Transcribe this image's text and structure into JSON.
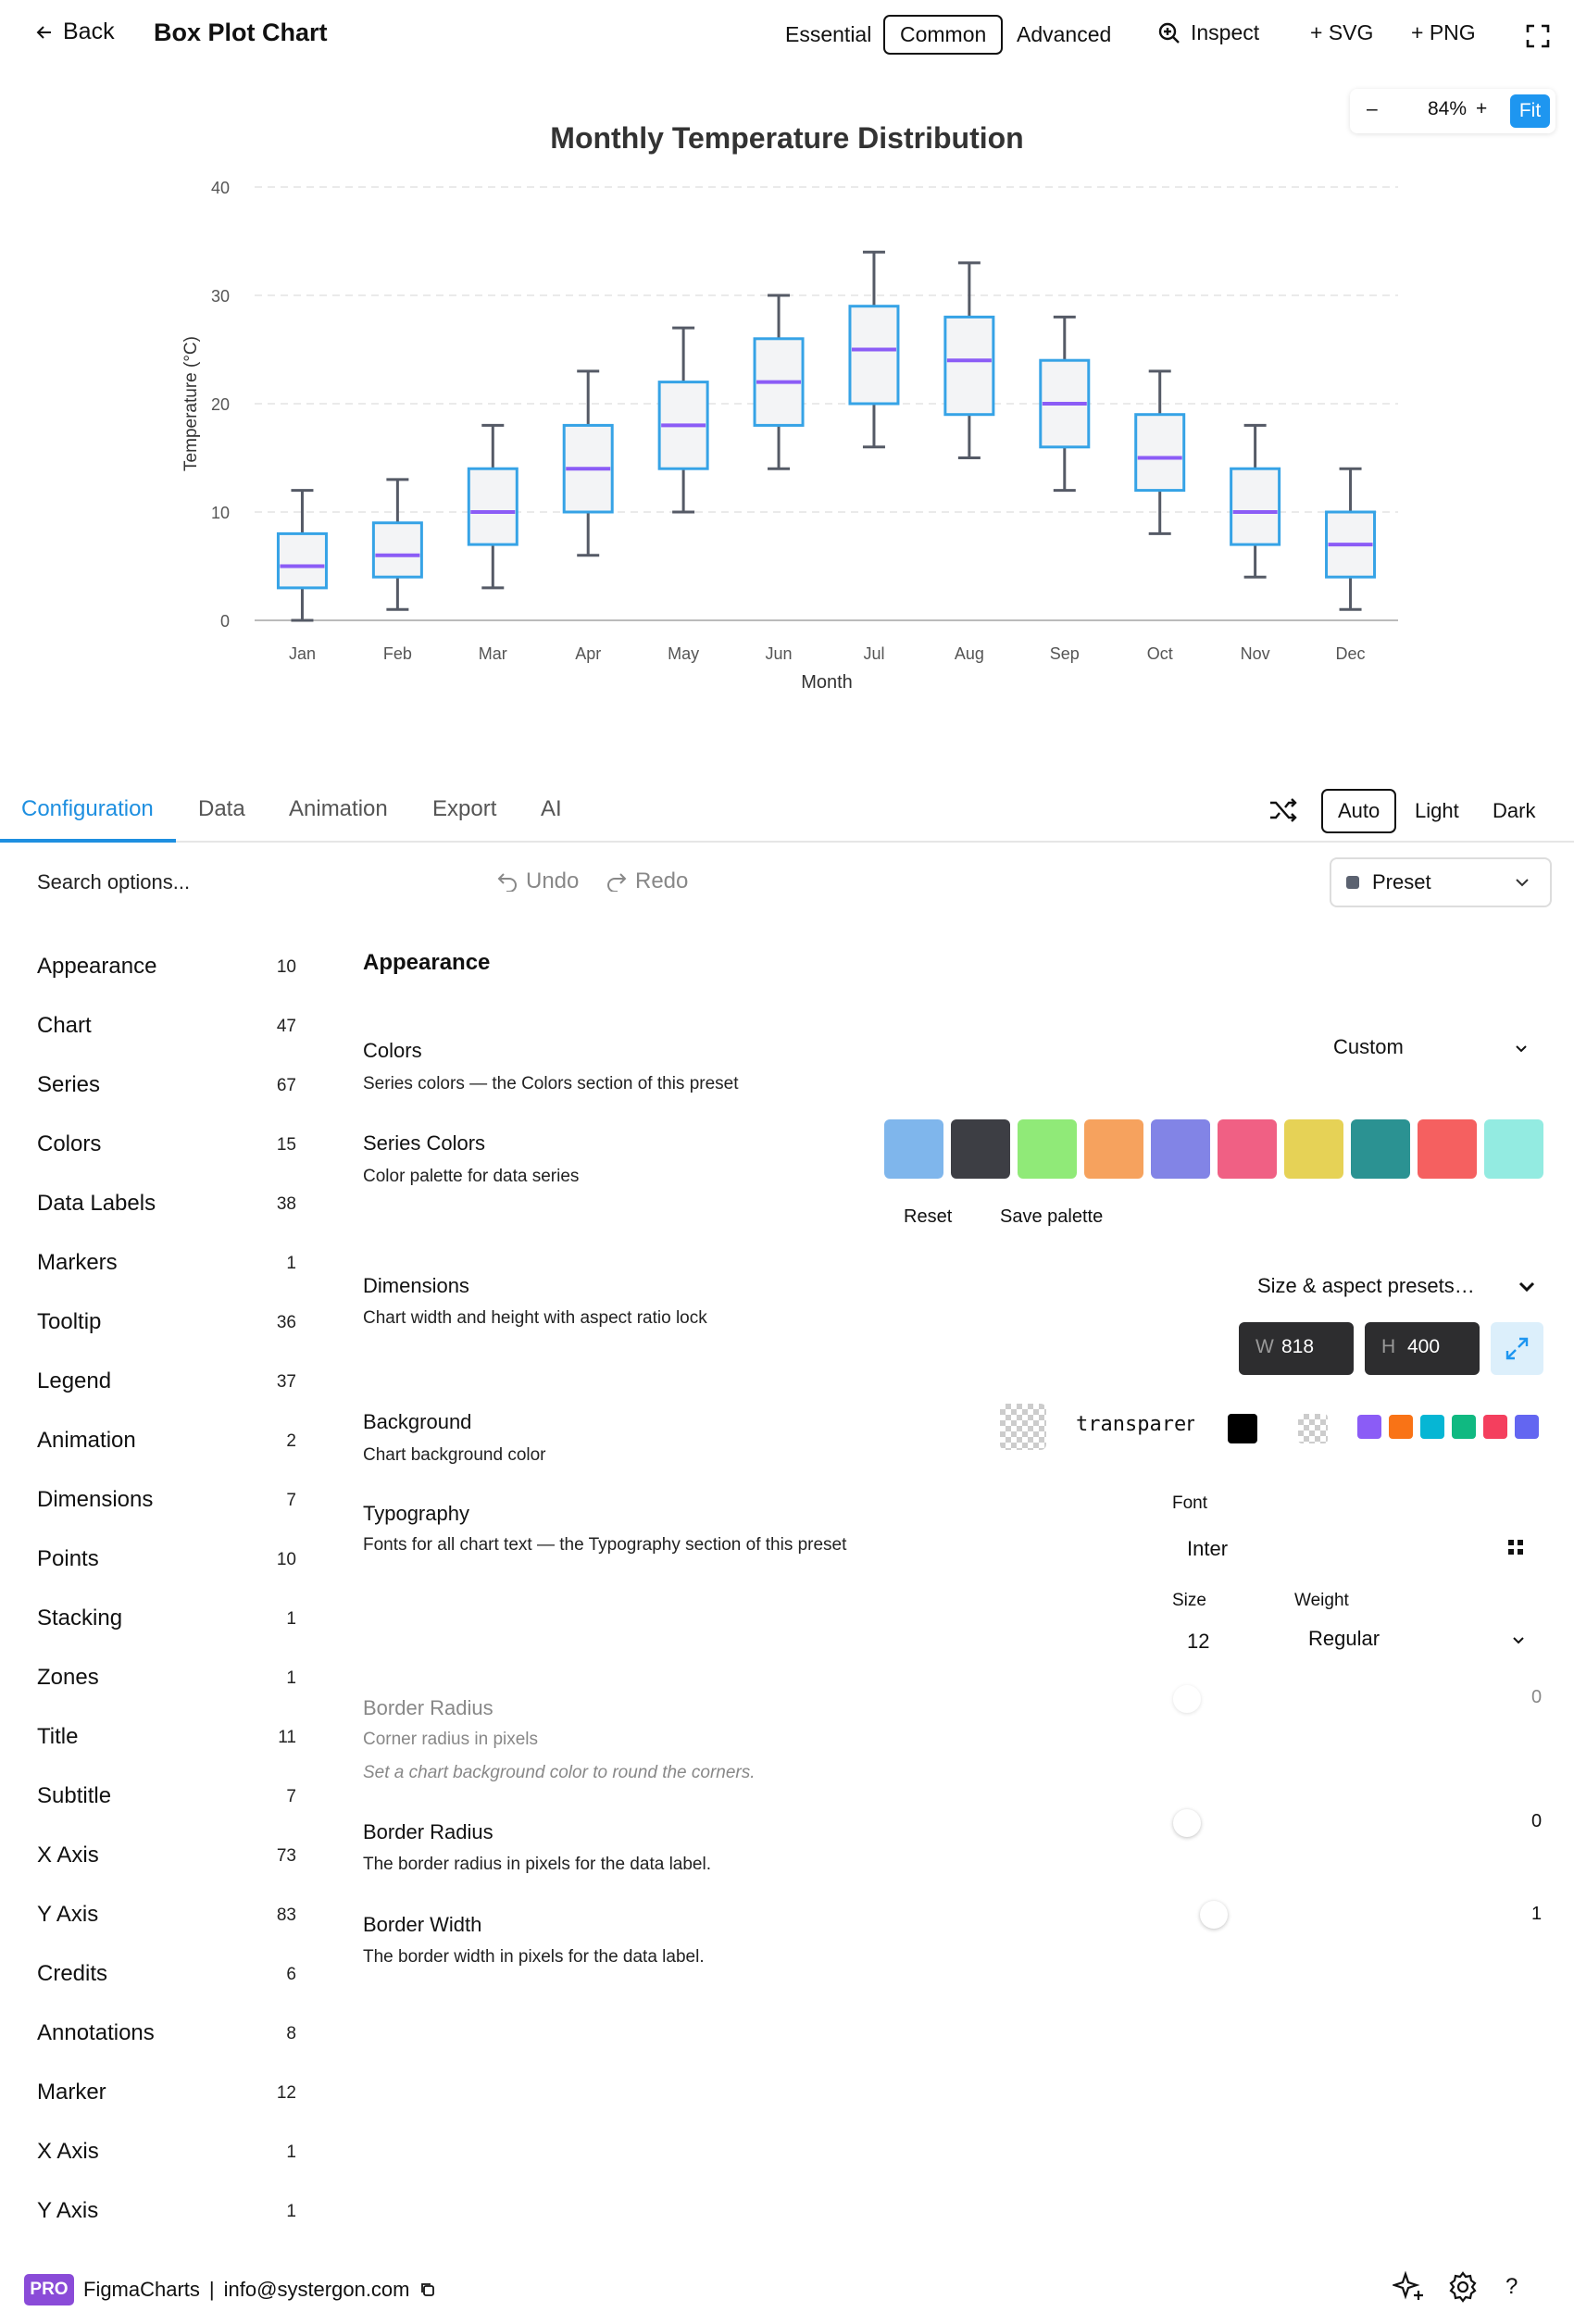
{
  "header": {
    "back_label": "Back",
    "title": "Box Plot Chart",
    "modes": [
      "Essential",
      "Common",
      "Advanced"
    ],
    "active_mode": "Common",
    "inspect_label": "Inspect",
    "svg_label": "+ SVG",
    "png_label": "+ PNG"
  },
  "zoom": {
    "minus": "–",
    "value": "84%",
    "plus": "+",
    "fit": "Fit"
  },
  "chart_data": {
    "type": "boxplot",
    "title": "Monthly Temperature Distribution",
    "xlabel": "Month",
    "ylabel": "Temperature (°C)",
    "ylim": [
      0,
      40
    ],
    "yticks": [
      0,
      10,
      20,
      30,
      40
    ],
    "grid": true,
    "categories": [
      "Jan",
      "Feb",
      "Mar",
      "Apr",
      "May",
      "Jun",
      "Jul",
      "Aug",
      "Sep",
      "Oct",
      "Nov",
      "Dec"
    ],
    "series": [
      {
        "values": [
          {
            "min": 0,
            "q1": 3,
            "median": 5,
            "q3": 8,
            "max": 12
          },
          {
            "min": 1,
            "q1": 4,
            "median": 6,
            "q3": 9,
            "max": 13
          },
          {
            "min": 3,
            "q1": 7,
            "median": 10,
            "q3": 14,
            "max": 18
          },
          {
            "min": 6,
            "q1": 10,
            "median": 14,
            "q3": 18,
            "max": 23
          },
          {
            "min": 10,
            "q1": 14,
            "median": 18,
            "q3": 22,
            "max": 27
          },
          {
            "min": 14,
            "q1": 18,
            "median": 22,
            "q3": 26,
            "max": 30
          },
          {
            "min": 16,
            "q1": 20,
            "median": 25,
            "q3": 29,
            "max": 34
          },
          {
            "min": 15,
            "q1": 19,
            "median": 24,
            "q3": 28,
            "max": 33
          },
          {
            "min": 12,
            "q1": 16,
            "median": 20,
            "q3": 24,
            "max": 28
          },
          {
            "min": 8,
            "q1": 12,
            "median": 15,
            "q3": 19,
            "max": 23
          },
          {
            "min": 4,
            "q1": 7,
            "median": 10,
            "q3": 14,
            "max": 18
          },
          {
            "min": 1,
            "q1": 4,
            "median": 7,
            "q3": 10,
            "max": 14
          }
        ]
      }
    ],
    "colors": {
      "box_stroke": "#36a3e6",
      "box_fill": "#f3f4f6",
      "median": "#8b5cf6",
      "whisker": "#555a66",
      "grid": "#e4e4e4"
    }
  },
  "tabs": {
    "items": [
      "Configuration",
      "Data",
      "Animation",
      "Export",
      "AI"
    ],
    "active": "Configuration",
    "themes": [
      "Auto",
      "Light",
      "Dark"
    ],
    "active_theme": "Auto"
  },
  "toolbar": {
    "search_placeholder": "Search options...",
    "undo": "Undo",
    "redo": "Redo",
    "preset": "Preset"
  },
  "sidebar": {
    "items": [
      {
        "label": "Appearance",
        "count": "10"
      },
      {
        "label": "Chart",
        "count": "47"
      },
      {
        "label": "Series",
        "count": "67"
      },
      {
        "label": "Colors",
        "count": "15"
      },
      {
        "label": "Data Labels",
        "count": "38"
      },
      {
        "label": "Markers",
        "count": "1"
      },
      {
        "label": "Tooltip",
        "count": "36"
      },
      {
        "label": "Legend",
        "count": "37"
      },
      {
        "label": "Animation",
        "count": "2"
      },
      {
        "label": "Dimensions",
        "count": "7"
      },
      {
        "label": "Points",
        "count": "10"
      },
      {
        "label": "Stacking",
        "count": "1"
      },
      {
        "label": "Zones",
        "count": "1"
      },
      {
        "label": "Title",
        "count": "11"
      },
      {
        "label": "Subtitle",
        "count": "7"
      },
      {
        "label": "X Axis",
        "count": "73"
      },
      {
        "label": "Y Axis",
        "count": "83"
      },
      {
        "label": "Credits",
        "count": "6"
      },
      {
        "label": "Annotations",
        "count": "8"
      },
      {
        "label": "Marker",
        "count": "12"
      },
      {
        "label": "X Axis",
        "count": "1"
      },
      {
        "label": "Y Axis",
        "count": "1"
      }
    ]
  },
  "settings": {
    "section_title": "Appearance",
    "colors": {
      "label": "Colors",
      "desc": "Series colors — the Colors section of this preset",
      "value": "Custom"
    },
    "series_colors": {
      "label": "Series Colors",
      "desc": "Color palette for data series",
      "palette": [
        "#7fb6ec",
        "#3d3e44",
        "#90ea78",
        "#f6a25e",
        "#8284e6",
        "#f06084",
        "#e6d256",
        "#2b9292",
        "#f56060",
        "#93ebe1"
      ],
      "reset": "Reset",
      "save": "Save palette"
    },
    "dimensions": {
      "label": "Dimensions",
      "desc": "Chart width and height with aspect ratio lock",
      "presets": "Size & aspect presets…",
      "w_label": "W",
      "w_value": "818",
      "h_label": "H",
      "h_value": "400"
    },
    "background": {
      "label": "Background",
      "desc": "Chart background color",
      "value": "transparent",
      "quick_colors": [
        "#8b5cf6",
        "#f97316",
        "#06b6d4",
        "#10b981",
        "#f43f5e",
        "#6366f1"
      ]
    },
    "typography": {
      "label": "Typography",
      "desc": "Fonts for all chart text — the Typography section of this preset",
      "font_label": "Font",
      "font_value": "Inter",
      "size_label": "Size",
      "size_value": "12",
      "weight_label": "Weight",
      "weight_value": "Regular"
    },
    "border_radius_disabled": {
      "label": "Border Radius",
      "desc": "Corner radius in pixels",
      "hint": "Set a chart background color to round the corners.",
      "value": "0"
    },
    "border_radius": {
      "label": "Border Radius",
      "desc": "The border radius in pixels for the data label.",
      "value": "0"
    },
    "border_width": {
      "label": "Border Width",
      "desc": "The border width in pixels for the data label.",
      "value": "1"
    }
  },
  "footer": {
    "badge": "PRO",
    "brand": "FigmaCharts",
    "separator": "|",
    "email": "info@systergon.com",
    "help": "?"
  }
}
